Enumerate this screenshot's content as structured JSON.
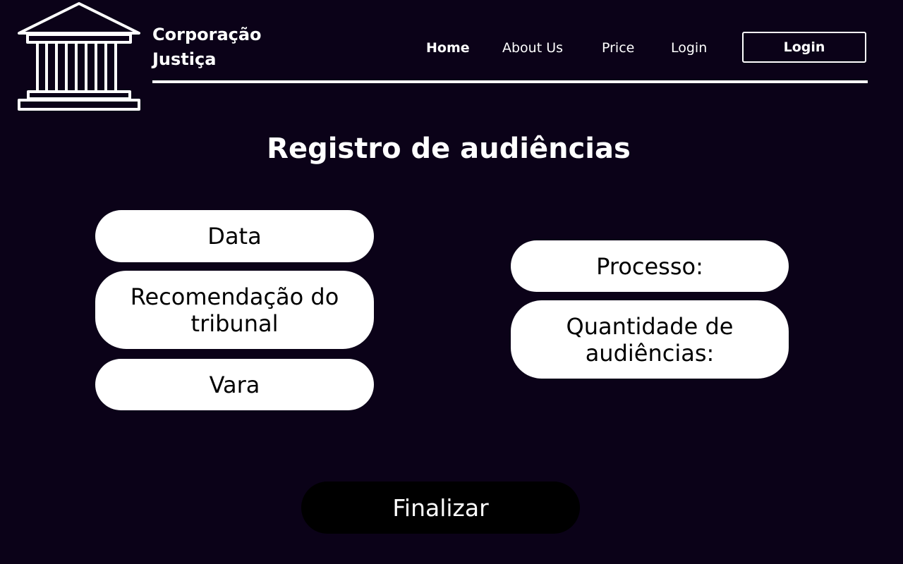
{
  "brand": {
    "logo_icon": "courthouse-columns-icon",
    "name_line1": "Corporação",
    "name_line2": "Justiça"
  },
  "nav": {
    "home": "Home",
    "about": "About Us",
    "price": "Price",
    "login_link": "Login",
    "login_button": "Login"
  },
  "page": {
    "title": "Registro de audiências"
  },
  "form": {
    "data": "Data",
    "recomendacao": "Recomendação do tribunal",
    "vara": "Vara",
    "processo": "Processo:",
    "quantidade": "Quantidade de audiências:"
  },
  "actions": {
    "finalize": "Finalizar"
  },
  "colors": {
    "background": "#0b0218",
    "foreground": "#ffffff",
    "field_background": "#ffffff",
    "field_text": "#000000",
    "button_background": "#000000"
  }
}
